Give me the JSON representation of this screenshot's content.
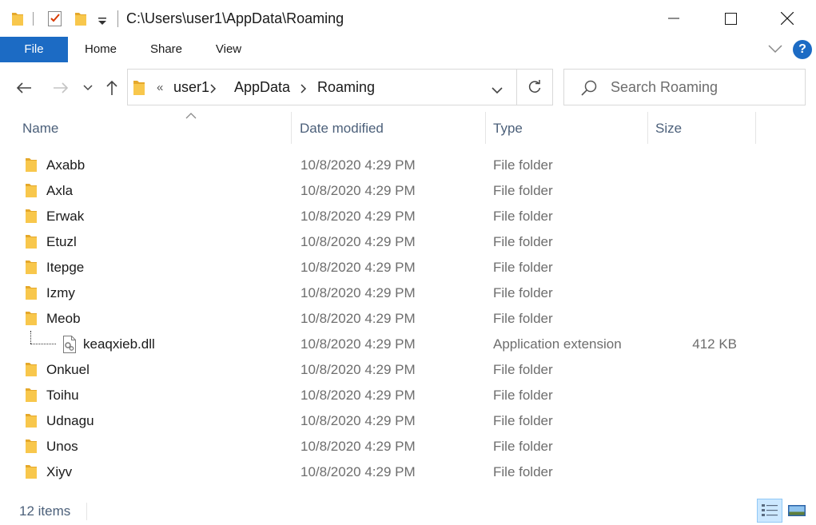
{
  "window": {
    "title": "C:\\Users\\user1\\AppData\\Roaming"
  },
  "ribbon": {
    "tabs": [
      {
        "label": "File",
        "active": true
      },
      {
        "label": "Home"
      },
      {
        "label": "Share"
      },
      {
        "label": "View"
      }
    ],
    "help_label": "?"
  },
  "address": {
    "overflow": "«",
    "crumbs": [
      "user1",
      "AppData",
      "Roaming"
    ]
  },
  "search": {
    "placeholder": "Search Roaming"
  },
  "columns": {
    "name": "Name",
    "date": "Date modified",
    "type": "Type",
    "size": "Size"
  },
  "rows": [
    {
      "name": "Axabb",
      "date": "10/8/2020 4:29 PM",
      "type": "File folder",
      "size": "",
      "kind": "folder"
    },
    {
      "name": "Axla",
      "date": "10/8/2020 4:29 PM",
      "type": "File folder",
      "size": "",
      "kind": "folder"
    },
    {
      "name": "Erwak",
      "date": "10/8/2020 4:29 PM",
      "type": "File folder",
      "size": "",
      "kind": "folder"
    },
    {
      "name": "Etuzl",
      "date": "10/8/2020 4:29 PM",
      "type": "File folder",
      "size": "",
      "kind": "folder"
    },
    {
      "name": "Itepge",
      "date": "10/8/2020 4:29 PM",
      "type": "File folder",
      "size": "",
      "kind": "folder"
    },
    {
      "name": "Izmy",
      "date": "10/8/2020 4:29 PM",
      "type": "File folder",
      "size": "",
      "kind": "folder"
    },
    {
      "name": "Meob",
      "date": "10/8/2020 4:29 PM",
      "type": "File folder",
      "size": "",
      "kind": "folder"
    },
    {
      "name": "keaqxieb.dll",
      "date": "10/8/2020 4:29 PM",
      "type": "Application extension",
      "size": "412 KB",
      "kind": "dll"
    },
    {
      "name": "Onkuel",
      "date": "10/8/2020 4:29 PM",
      "type": "File folder",
      "size": "",
      "kind": "folder"
    },
    {
      "name": "Toihu",
      "date": "10/8/2020 4:29 PM",
      "type": "File folder",
      "size": "",
      "kind": "folder"
    },
    {
      "name": "Udnagu",
      "date": "10/8/2020 4:29 PM",
      "type": "File folder",
      "size": "",
      "kind": "folder"
    },
    {
      "name": "Unos",
      "date": "10/8/2020 4:29 PM",
      "type": "File folder",
      "size": "",
      "kind": "folder"
    },
    {
      "name": "Xiyv",
      "date": "10/8/2020 4:29 PM",
      "type": "File folder",
      "size": "",
      "kind": "folder"
    }
  ],
  "status": {
    "item_count": "12 items"
  },
  "colors": {
    "accent": "#1c6bc4",
    "folder": "#f8c74c",
    "header_text": "#4c607a"
  }
}
